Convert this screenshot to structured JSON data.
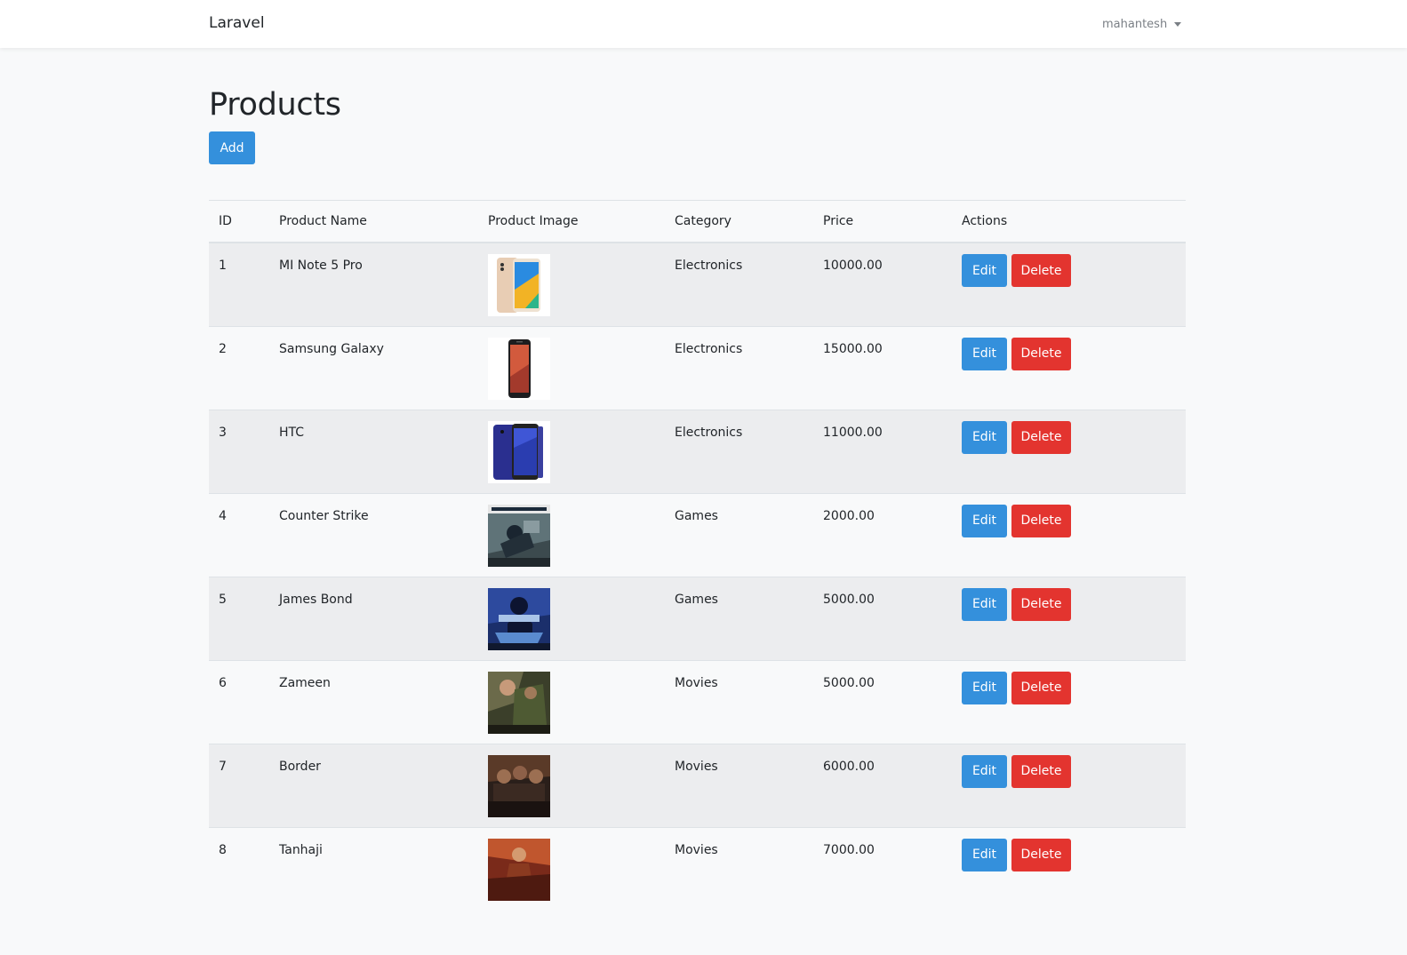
{
  "navbar": {
    "brand": "Laravel",
    "user": "mahantesh"
  },
  "page": {
    "title": "Products",
    "add_label": "Add"
  },
  "colors": {
    "primary": "#3490dc",
    "danger": "#e3342f",
    "stripe": "#ecedef"
  },
  "table": {
    "headers": [
      "ID",
      "Product Name",
      "Product Image",
      "Category",
      "Price",
      "Actions"
    ],
    "edit_label": "Edit",
    "delete_label": "Delete",
    "rows": [
      {
        "id": "1",
        "name": "MI Note 5 Pro",
        "image": "phone-gold-thumbnail",
        "category": "Electronics",
        "price": "10000.00"
      },
      {
        "id": "2",
        "name": "Samsung Galaxy",
        "image": "phone-black-thumbnail",
        "category": "Electronics",
        "price": "15000.00"
      },
      {
        "id": "3",
        "name": "HTC",
        "image": "phone-blue-thumbnail",
        "category": "Electronics",
        "price": "11000.00"
      },
      {
        "id": "4",
        "name": "Counter Strike",
        "image": "game-cover-thumbnail",
        "category": "Games",
        "price": "2000.00"
      },
      {
        "id": "5",
        "name": "James Bond",
        "image": "game-cover-thumbnail",
        "category": "Games",
        "price": "5000.00"
      },
      {
        "id": "6",
        "name": "Zameen",
        "image": "movie-poster-thumbnail",
        "category": "Movies",
        "price": "5000.00"
      },
      {
        "id": "7",
        "name": "Border",
        "image": "movie-poster-thumbnail",
        "category": "Movies",
        "price": "6000.00"
      },
      {
        "id": "8",
        "name": "Tanhaji",
        "image": "movie-poster-thumbnail",
        "category": "Movies",
        "price": "7000.00"
      }
    ]
  }
}
